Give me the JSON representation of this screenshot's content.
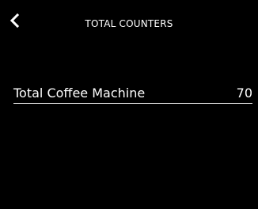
{
  "header": {
    "title": "TOTAL COUNTERS",
    "back_icon": "chevron-left-icon"
  },
  "counters": [
    {
      "label": "Total Coffee Machine",
      "value": "70"
    }
  ],
  "colors": {
    "background": "#000000",
    "text": "#ffffff"
  }
}
